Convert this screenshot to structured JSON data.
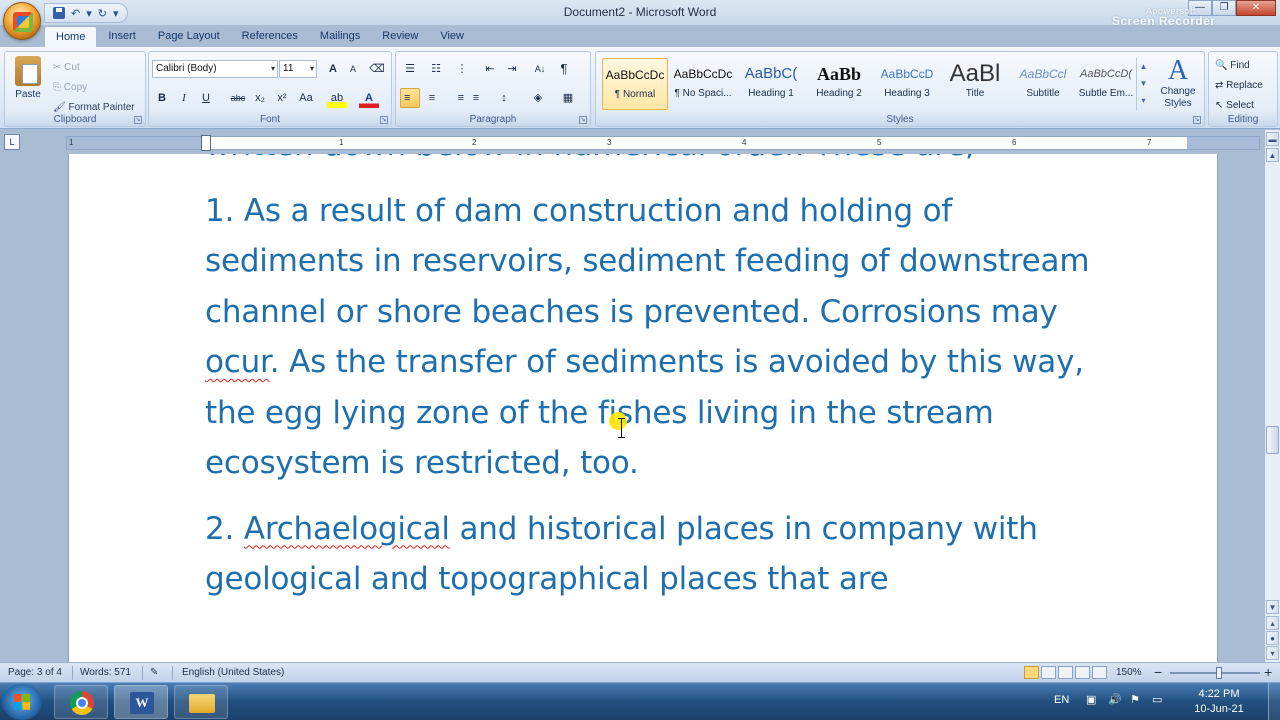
{
  "window": {
    "title": "Document2 - Microsoft Word",
    "qat_undo": "↶",
    "qat_redo": "↻",
    "qat_more": "▾",
    "controls": {
      "minimize": "—",
      "maximize": "❐",
      "close": "✕"
    },
    "recorder_label": "Screen Recorder",
    "recorder_brand": "Apowersoft"
  },
  "tabs": [
    {
      "label": "Home"
    },
    {
      "label": "Insert"
    },
    {
      "label": "Page Layout"
    },
    {
      "label": "References"
    },
    {
      "label": "Mailings"
    },
    {
      "label": "Review"
    },
    {
      "label": "View"
    }
  ],
  "ribbon": {
    "clipboard": {
      "label": "Clipboard",
      "paste": "Paste",
      "cut": "Cut",
      "copy": "Copy",
      "format_painter": "Format Painter"
    },
    "font": {
      "label": "Font",
      "font_name": "Calibri (Body)",
      "font_size": "11",
      "buttons": {
        "grow": "A",
        "shrink": "A",
        "clear": "⌫",
        "bold": "B",
        "italic": "I",
        "underline": "U",
        "strike": "abc",
        "sub": "x₂",
        "sup": "x²",
        "case": "Aa",
        "highlight": "ab",
        "color": "A"
      }
    },
    "paragraph": {
      "label": "Paragraph",
      "buttons": {
        "bullets": "☰",
        "numbering": "☷",
        "multilevel": "⋮",
        "dec_indent": "⇤",
        "inc_indent": "⇥",
        "sort": "A↓",
        "pilcrow": "¶",
        "align_left": "≡",
        "center": "≡",
        "align_right": "≡",
        "justify": "≡",
        "spacing": "↕",
        "shading": "◈",
        "borders": "▦"
      }
    },
    "styles": {
      "label": "Styles",
      "items": [
        {
          "sample": "AaBbCcDc",
          "name": "¶ Normal"
        },
        {
          "sample": "AaBbCcDc",
          "name": "¶ No Spaci..."
        },
        {
          "sample": "AaBbC(",
          "name": "Heading 1"
        },
        {
          "sample": "AaBb",
          "name": "Heading 2"
        },
        {
          "sample": "AaBbCcD",
          "name": "Heading 3"
        },
        {
          "sample": "AaBl",
          "name": "Title"
        },
        {
          "sample": "AaBbCcl",
          "name": "Subtitle"
        },
        {
          "sample": "AaBbCcD(",
          "name": "Subtle Em..."
        }
      ],
      "change_styles": "Change Styles",
      "change_icon": "A"
    },
    "editing": {
      "label": "Editing",
      "find": "Find",
      "replace": "Replace",
      "select": "Select"
    }
  },
  "ruler": {
    "corner": "L",
    "numbers": [
      "1",
      "1",
      "2",
      "3",
      "4",
      "5",
      "6",
      "7"
    ]
  },
  "document": {
    "cut_line": "written down below in numerical order. These are;",
    "para1": {
      "a": "1. As a result of dam construction and holding of sediments in reservoirs, sediment feeding of downstream channel or shore beaches is prevented. Corrosions may ",
      "misspelled": "ocur",
      "b": ". As the transfer of sediments is avoided by this way, the egg lying zone of the fishes living in the stream ecosystem is restricted, too."
    },
    "para2": {
      "a": "2. ",
      "misspelled": "Archaelogical",
      "b": " and historical places in company with geological and topographical places that are"
    }
  },
  "statusbar": {
    "page": "Page: 3 of 4",
    "words": "Words: 571",
    "language": "English (United States)",
    "zoom": "150%",
    "zoom_minus": "−",
    "zoom_plus": "+"
  },
  "taskbar": {
    "lang": "EN",
    "time": "4:22 PM",
    "date": "10-Jun-21"
  }
}
